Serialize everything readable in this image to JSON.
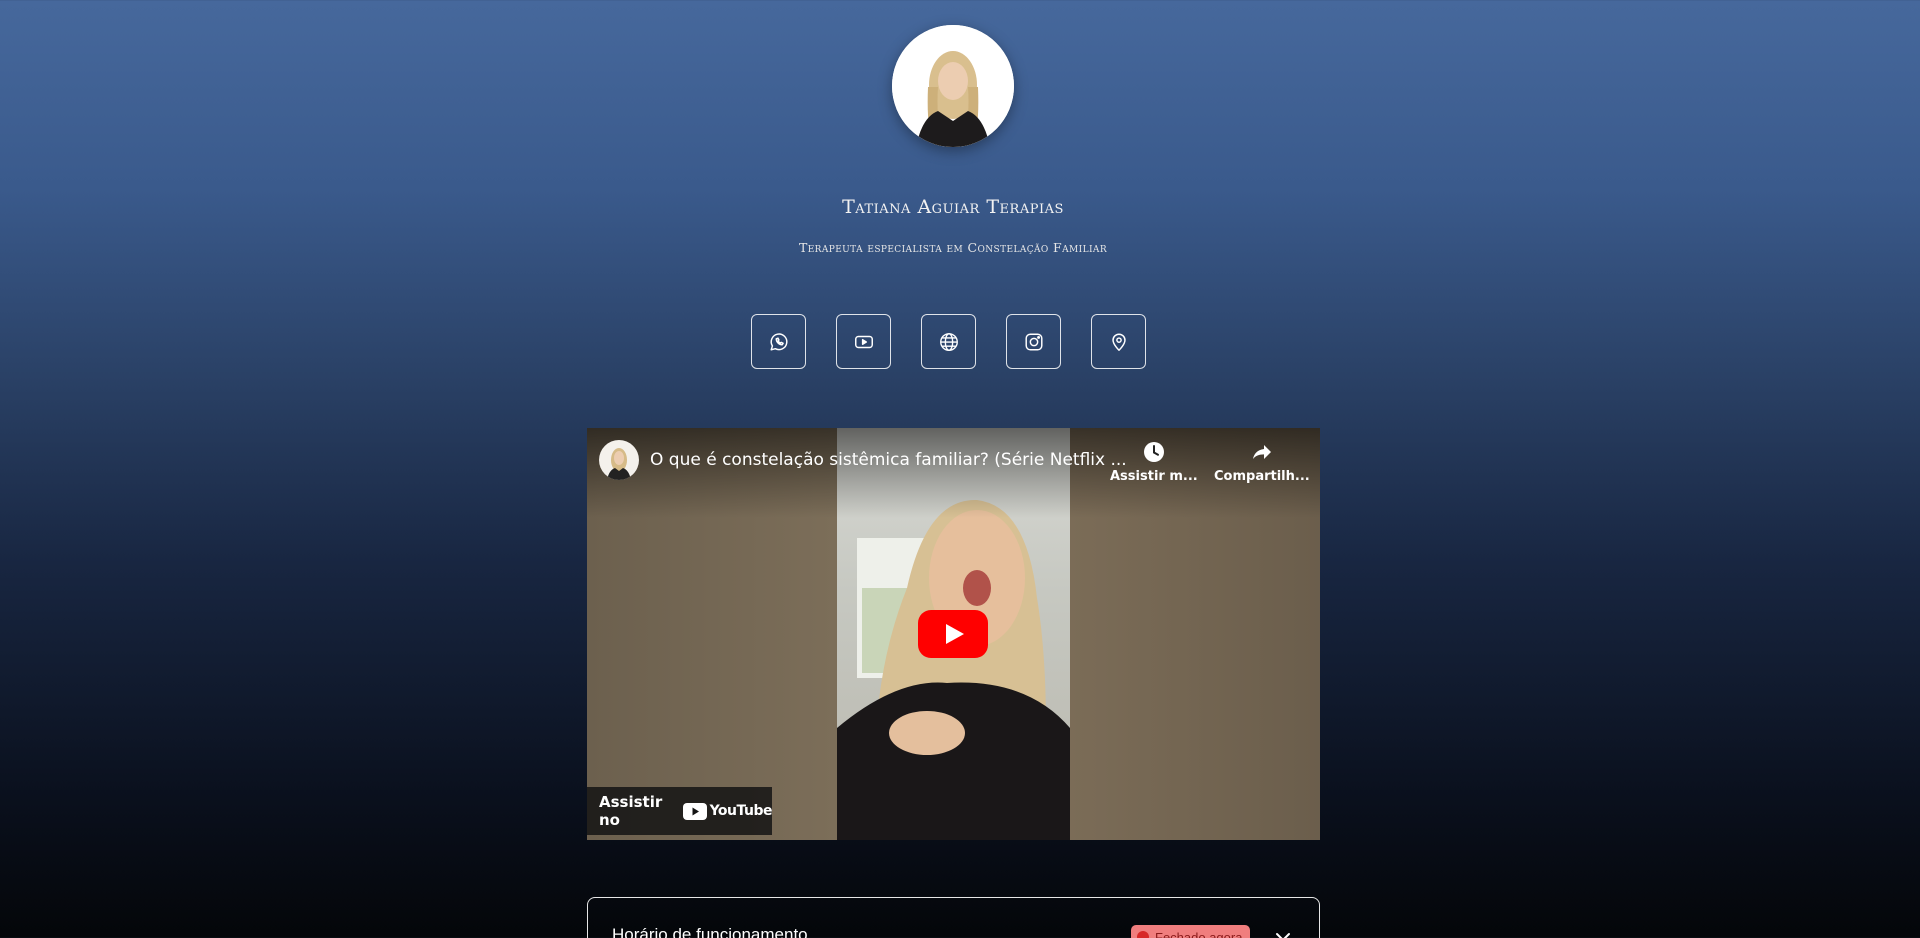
{
  "profile": {
    "name": "Tatiana Aguiar Terapias",
    "tagline": "Terapeuta especialista em Constelação Familiar"
  },
  "socials": [
    {
      "icon": "whatsapp-icon"
    },
    {
      "icon": "youtube-icon"
    },
    {
      "icon": "globe-icon"
    },
    {
      "icon": "instagram-icon"
    },
    {
      "icon": "map-pin-icon"
    }
  ],
  "video": {
    "title": "O que é constelação sistêmica familiar? (Série Netflix ...",
    "watch_later_label": "Assistir m...",
    "share_label": "Compartilh...",
    "watch_on_label": "Assistir no",
    "youtube_wordmark": "YouTube"
  },
  "hours": {
    "label": "Horário de funcionamento",
    "status": "Fechado agora"
  },
  "colors": {
    "youtube_red": "#ff0000",
    "status_badge_bg": "#f07e7e",
    "status_dot": "#d72828"
  }
}
